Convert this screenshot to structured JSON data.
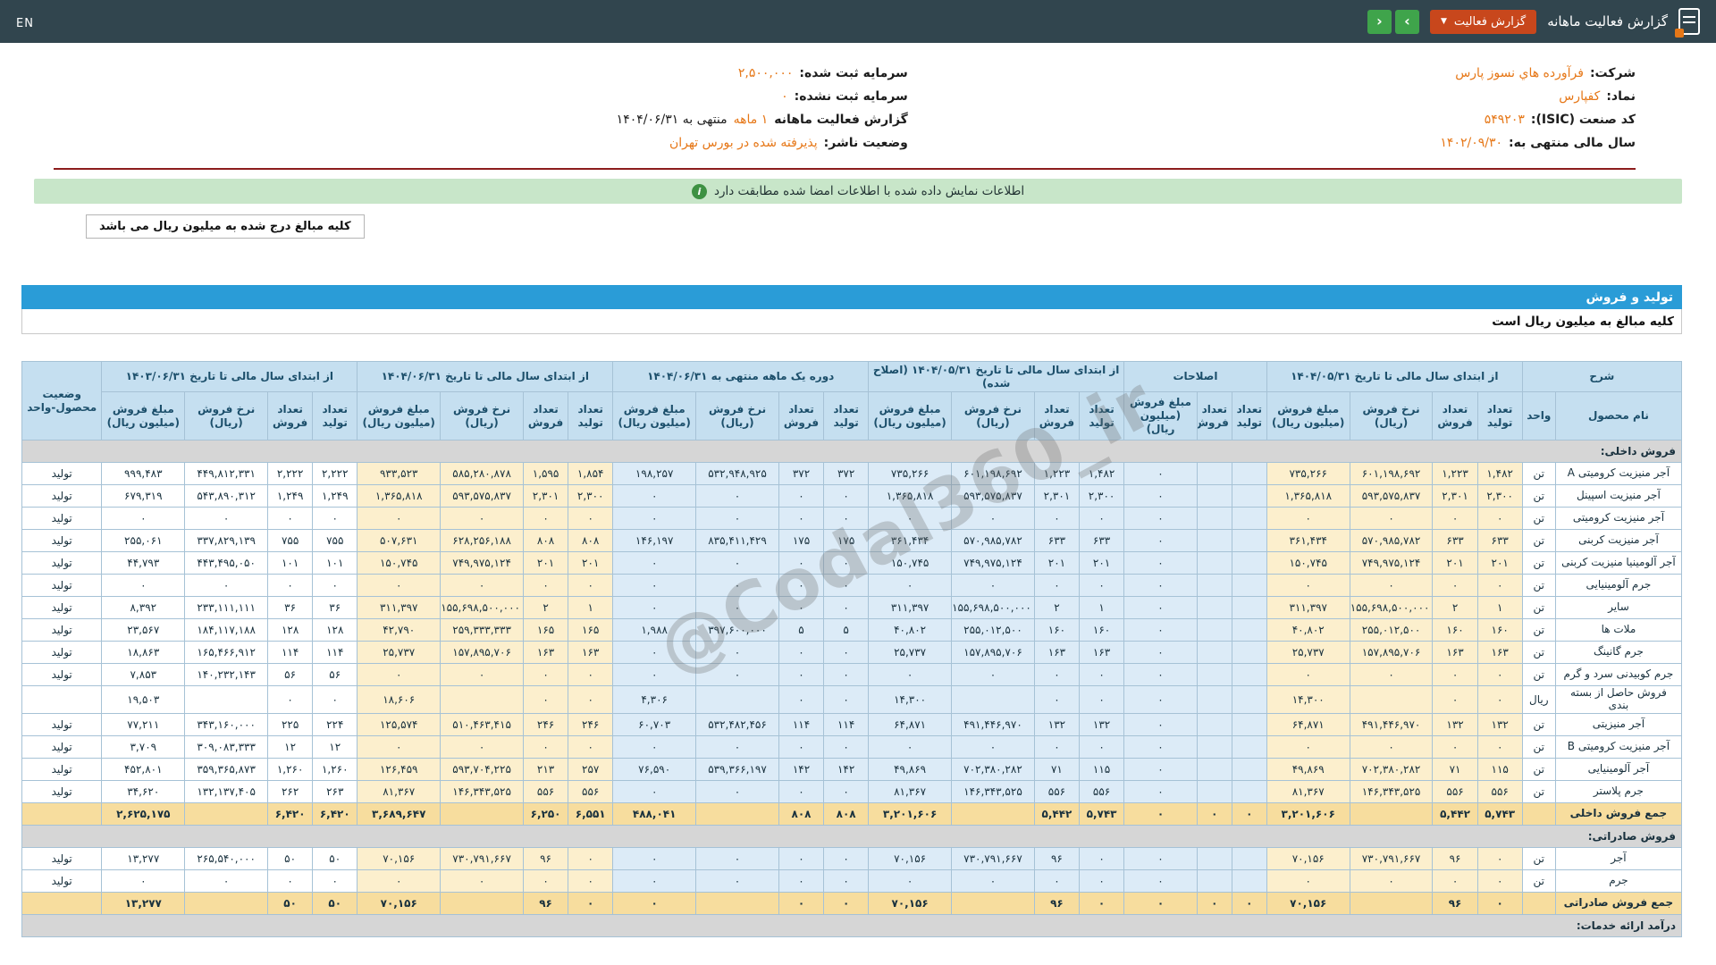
{
  "colors": {
    "topbar": "#31454e",
    "accent_orange": "#e67717",
    "button_red": "#c8471c",
    "button_green": "#3fa44b",
    "banner_green": "#c8e6c9",
    "bar_blue": "#2a9cd7",
    "header_blue": "#c5dff0",
    "header_text": "#1c4f6b",
    "cell_cream": "#fcefcd",
    "cell_blue": "#dcebf7",
    "total_yellow": "#f7dd9e",
    "section_gray": "#d6d6d6",
    "table_border": "#a6c2d6",
    "red_line": "#8c1d1d"
  },
  "topbar": {
    "title": "گزارش فعالیت ماهانه",
    "dropdown_label": "گزارش فعالیت",
    "dropdown_chevron": "▼",
    "nav_right": "›",
    "nav_left": "‹",
    "en_label": "EN"
  },
  "info": {
    "right": [
      {
        "label": "شرکت:",
        "value": "فرآورده هاي نسوز پارس",
        "suffix": ""
      },
      {
        "label": "نماد:",
        "value": "کفپارس",
        "suffix": ""
      },
      {
        "label": "کد صنعت (ISIC):",
        "value": "۵۴۹۲۰۳",
        "suffix": ""
      },
      {
        "label": "سال مالی منتهی به:",
        "value": "۱۴۰۲/۰۹/۳۰",
        "suffix": ""
      }
    ],
    "left": [
      {
        "label": "سرمایه ثبت شده:",
        "value": "۲,۵۰۰,۰۰۰",
        "suffix": ""
      },
      {
        "label": "سرمایه ثبت نشده:",
        "value": "۰",
        "suffix": ""
      },
      {
        "label": "گزارش فعالیت ماهانه",
        "value": "۱ ماهه",
        "suffix": "منتهی به ۱۴۰۴/۰۶/۳۱"
      },
      {
        "label": "وضعیت ناشر:",
        "value": "پذیرفته شده در بورس تهران",
        "suffix": ""
      }
    ]
  },
  "banner": {
    "text": "اطلاعات نمایش داده شده با اطلاعات امضا شده مطابقت دارد",
    "icon": "i"
  },
  "amounts_note": "کلیه مبالغ درج شده به میلیون ریال می باشد",
  "section_bar": "تولید و فروش",
  "table_note": "کلیه مبالغ به میلیون ریال است",
  "watermark": "@Codal360_ir",
  "table": {
    "desc_header": "شرح",
    "sub_name": "نام محصول",
    "sub_unit": "واحد",
    "status_header": "وضعیت محصول-واحد",
    "groups": [
      {
        "key": "ytd_0531",
        "shade": "s-cream",
        "label": "از ابتدای سال مالی تا تاریخ ۱۴۰۴/۰۵/۳۱",
        "cols": [
          "تعداد تولید",
          "تعداد فروش",
          "نرخ فروش (ریال)",
          "مبلغ فروش (میلیون ریال)"
        ]
      },
      {
        "key": "adjustments",
        "shade": "s-blue",
        "label": "اصلاحات",
        "cols": [
          "تعداد تولید",
          "تعداد فروش",
          "مبلغ فروش (میلیون ریال)"
        ]
      },
      {
        "key": "ytd_0531_adjusted",
        "shade": "s-blue",
        "label": "از ابتدای سال مالی تا تاریخ ۱۴۰۴/۰۵/۳۱ (اصلاح شده)",
        "cols": [
          "تعداد تولید",
          "تعداد فروش",
          "نرخ فروش (ریال)",
          "مبلغ فروش (میلیون ریال)"
        ]
      },
      {
        "key": "month_0631",
        "shade": "s-blue",
        "label": "دوره یک ماهه منتهی به ۱۴۰۴/۰۶/۳۱",
        "cols": [
          "تعداد تولید",
          "تعداد فروش",
          "نرخ فروش (ریال)",
          "مبلغ فروش (میلیون ریال)"
        ]
      },
      {
        "key": "ytd_0631",
        "shade": "s-cream",
        "label": "از ابتدای سال مالی تا تاریخ ۱۴۰۴/۰۶/۳۱",
        "cols": [
          "تعداد تولید",
          "تعداد فروش",
          "نرخ فروش (ریال)",
          "مبلغ فروش (میلیون ریال)"
        ]
      },
      {
        "key": "prev_1403",
        "shade": "s-plain",
        "label": "از ابتدای سال مالی تا تاریخ ۱۴۰۳/۰۶/۳۱",
        "cols": [
          "تعداد تولید",
          "تعداد فروش",
          "نرخ فروش (ریال)",
          "مبلغ فروش (میلیون ریال)"
        ]
      }
    ],
    "rows": [
      {
        "type": "section",
        "label": "فروش داخلی:"
      },
      {
        "type": "data",
        "name": "آجر منیزیت کرومیتی A",
        "unit": "تن",
        "status": "تولید",
        "values": {
          "ytd_0531": [
            "۱,۴۸۲",
            "۱,۲۲۳",
            "۶۰۱,۱۹۸,۶۹۲",
            "۷۳۵,۲۶۶"
          ],
          "adjustments": [
            "",
            "",
            "۰"
          ],
          "ytd_0531_adjusted": [
            "۱,۴۸۲",
            "۱,۲۲۳",
            "۶۰۱,۱۹۸,۶۹۲",
            "۷۳۵,۲۶۶"
          ],
          "month_0631": [
            "۳۷۲",
            "۳۷۲",
            "۵۳۲,۹۴۸,۹۲۵",
            "۱۹۸,۲۵۷"
          ],
          "ytd_0631": [
            "۱,۸۵۴",
            "۱,۵۹۵",
            "۵۸۵,۲۸۰,۸۷۸",
            "۹۳۳,۵۲۳"
          ],
          "prev_1403": [
            "۲,۲۲۲",
            "۲,۲۲۲",
            "۴۴۹,۸۱۲,۳۳۱",
            "۹۹۹,۴۸۳"
          ]
        }
      },
      {
        "type": "data",
        "name": "آجر منیزیت اسپینل",
        "unit": "تن",
        "status": "تولید",
        "values": {
          "ytd_0531": [
            "۲,۳۰۰",
            "۲,۳۰۱",
            "۵۹۳,۵۷۵,۸۳۷",
            "۱,۳۶۵,۸۱۸"
          ],
          "adjustments": [
            "",
            "",
            "۰"
          ],
          "ytd_0531_adjusted": [
            "۲,۳۰۰",
            "۲,۳۰۱",
            "۵۹۳,۵۷۵,۸۳۷",
            "۱,۳۶۵,۸۱۸"
          ],
          "month_0631": [
            "۰",
            "۰",
            "۰",
            "۰"
          ],
          "ytd_0631": [
            "۲,۳۰۰",
            "۲,۳۰۱",
            "۵۹۳,۵۷۵,۸۳۷",
            "۱,۳۶۵,۸۱۸"
          ],
          "prev_1403": [
            "۱,۲۴۹",
            "۱,۲۴۹",
            "۵۴۳,۸۹۰,۳۱۲",
            "۶۷۹,۳۱۹"
          ]
        }
      },
      {
        "type": "data",
        "name": "آجر منیزیت کرومیتی",
        "unit": "تن",
        "status": "تولید",
        "values": {
          "ytd_0531": [
            "۰",
            "۰",
            "۰",
            "۰"
          ],
          "adjustments": [
            "",
            "",
            "۰"
          ],
          "ytd_0531_adjusted": [
            "۰",
            "۰",
            "۰",
            "۰"
          ],
          "month_0631": [
            "۰",
            "۰",
            "۰",
            "۰"
          ],
          "ytd_0631": [
            "۰",
            "۰",
            "۰",
            "۰"
          ],
          "prev_1403": [
            "۰",
            "۰",
            "۰",
            "۰"
          ]
        }
      },
      {
        "type": "data",
        "name": "آجر منیزیت کربنی",
        "unit": "تن",
        "status": "تولید",
        "values": {
          "ytd_0531": [
            "۶۳۳",
            "۶۳۳",
            "۵۷۰,۹۸۵,۷۸۲",
            "۳۶۱,۴۳۴"
          ],
          "adjustments": [
            "",
            "",
            "۰"
          ],
          "ytd_0531_adjusted": [
            "۶۳۳",
            "۶۳۳",
            "۵۷۰,۹۸۵,۷۸۲",
            "۳۶۱,۴۳۴"
          ],
          "month_0631": [
            "۱۷۵",
            "۱۷۵",
            "۸۳۵,۴۱۱,۴۲۹",
            "۱۴۶,۱۹۷"
          ],
          "ytd_0631": [
            "۸۰۸",
            "۸۰۸",
            "۶۲۸,۲۵۶,۱۸۸",
            "۵۰۷,۶۳۱"
          ],
          "prev_1403": [
            "۷۵۵",
            "۷۵۵",
            "۳۳۷,۸۲۹,۱۳۹",
            "۲۵۵,۰۶۱"
          ]
        }
      },
      {
        "type": "data",
        "name": "آجر آلومینیا منیزیت کربنی",
        "unit": "تن",
        "status": "تولید",
        "values": {
          "ytd_0531": [
            "۲۰۱",
            "۲۰۱",
            "۷۴۹,۹۷۵,۱۲۴",
            "۱۵۰,۷۴۵"
          ],
          "adjustments": [
            "",
            "",
            "۰"
          ],
          "ytd_0531_adjusted": [
            "۲۰۱",
            "۲۰۱",
            "۷۴۹,۹۷۵,۱۲۴",
            "۱۵۰,۷۴۵"
          ],
          "month_0631": [
            "۰",
            "۰",
            "۰",
            "۰"
          ],
          "ytd_0631": [
            "۲۰۱",
            "۲۰۱",
            "۷۴۹,۹۷۵,۱۲۴",
            "۱۵۰,۷۴۵"
          ],
          "prev_1403": [
            "۱۰۱",
            "۱۰۱",
            "۴۴۳,۴۹۵,۰۵۰",
            "۴۴,۷۹۳"
          ]
        }
      },
      {
        "type": "data",
        "name": "جرم آلومینیایی",
        "unit": "تن",
        "status": "تولید",
        "values": {
          "ytd_0531": [
            "۰",
            "۰",
            "۰",
            "۰"
          ],
          "adjustments": [
            "",
            "",
            "۰"
          ],
          "ytd_0531_adjusted": [
            "۰",
            "۰",
            "۰",
            "۰"
          ],
          "month_0631": [
            "۰",
            "۰",
            "۰",
            "۰"
          ],
          "ytd_0631": [
            "۰",
            "۰",
            "۰",
            "۰"
          ],
          "prev_1403": [
            "۰",
            "۰",
            "۰",
            "۰"
          ]
        }
      },
      {
        "type": "data",
        "name": "سایر",
        "unit": "تن",
        "status": "تولید",
        "values": {
          "ytd_0531": [
            "۱",
            "۲",
            "۱۵۵,۶۹۸,۵۰۰,۰۰۰",
            "۳۱۱,۳۹۷"
          ],
          "adjustments": [
            "",
            "",
            "۰"
          ],
          "ytd_0531_adjusted": [
            "۱",
            "۲",
            "۱۵۵,۶۹۸,۵۰۰,۰۰۰",
            "۳۱۱,۳۹۷"
          ],
          "month_0631": [
            "۰",
            "۰",
            "۰",
            "۰"
          ],
          "ytd_0631": [
            "۱",
            "۲",
            "۱۵۵,۶۹۸,۵۰۰,۰۰۰",
            "۳۱۱,۳۹۷"
          ],
          "prev_1403": [
            "۳۶",
            "۳۶",
            "۲۳۳,۱۱۱,۱۱۱",
            "۸,۳۹۲"
          ]
        }
      },
      {
        "type": "data",
        "name": "ملات ها",
        "unit": "تن",
        "status": "تولید",
        "values": {
          "ytd_0531": [
            "۱۶۰",
            "۱۶۰",
            "۲۵۵,۰۱۲,۵۰۰",
            "۴۰,۸۰۲"
          ],
          "adjustments": [
            "",
            "",
            "۰"
          ],
          "ytd_0531_adjusted": [
            "۱۶۰",
            "۱۶۰",
            "۲۵۵,۰۱۲,۵۰۰",
            "۴۰,۸۰۲"
          ],
          "month_0631": [
            "۵",
            "۵",
            "۳۹۷,۶۰۰,۰۰۰",
            "۱,۹۸۸"
          ],
          "ytd_0631": [
            "۱۶۵",
            "۱۶۵",
            "۲۵۹,۳۳۳,۳۳۳",
            "۴۲,۷۹۰"
          ],
          "prev_1403": [
            "۱۲۸",
            "۱۲۸",
            "۱۸۴,۱۱۷,۱۸۸",
            "۲۳,۵۶۷"
          ]
        }
      },
      {
        "type": "data",
        "name": "جرم گانینگ",
        "unit": "تن",
        "status": "تولید",
        "values": {
          "ytd_0531": [
            "۱۶۳",
            "۱۶۳",
            "۱۵۷,۸۹۵,۷۰۶",
            "۲۵,۷۳۷"
          ],
          "adjustments": [
            "",
            "",
            "۰"
          ],
          "ytd_0531_adjusted": [
            "۱۶۳",
            "۱۶۳",
            "۱۵۷,۸۹۵,۷۰۶",
            "۲۵,۷۳۷"
          ],
          "month_0631": [
            "۰",
            "۰",
            "۰",
            "۰"
          ],
          "ytd_0631": [
            "۱۶۳",
            "۱۶۳",
            "۱۵۷,۸۹۵,۷۰۶",
            "۲۵,۷۳۷"
          ],
          "prev_1403": [
            "۱۱۴",
            "۱۱۴",
            "۱۶۵,۴۶۶,۹۱۲",
            "۱۸,۸۶۳"
          ]
        }
      },
      {
        "type": "data",
        "name": "جرم کوبیدنی سرد و گرم",
        "unit": "تن",
        "status": "تولید",
        "values": {
          "ytd_0531": [
            "۰",
            "۰",
            "۰",
            "۰"
          ],
          "adjustments": [
            "",
            "",
            "۰"
          ],
          "ytd_0531_adjusted": [
            "۰",
            "۰",
            "۰",
            "۰"
          ],
          "month_0631": [
            "۰",
            "۰",
            "۰",
            "۰"
          ],
          "ytd_0631": [
            "۰",
            "۰",
            "۰",
            "۰"
          ],
          "prev_1403": [
            "۵۶",
            "۵۶",
            "۱۴۰,۲۳۲,۱۴۳",
            "۷,۸۵۳"
          ]
        }
      },
      {
        "type": "data",
        "name": "فروش حاصل از بسته بندی",
        "unit": "ریال",
        "status": "",
        "values": {
          "ytd_0531": [
            "۰",
            "۰",
            "",
            "۱۴,۳۰۰"
          ],
          "adjustments": [
            "",
            "",
            "۰"
          ],
          "ytd_0531_adjusted": [
            "۰",
            "۰",
            "",
            "۱۴,۳۰۰"
          ],
          "month_0631": [
            "۰",
            "۰",
            "",
            "۴,۳۰۶"
          ],
          "ytd_0631": [
            "۰",
            "۰",
            "",
            "۱۸,۶۰۶"
          ],
          "prev_1403": [
            "۰",
            "۰",
            "",
            "۱۹,۵۰۳"
          ]
        }
      },
      {
        "type": "data",
        "name": "آجر منیزیتی",
        "unit": "تن",
        "status": "تولید",
        "values": {
          "ytd_0531": [
            "۱۳۲",
            "۱۳۲",
            "۴۹۱,۴۴۶,۹۷۰",
            "۶۴,۸۷۱"
          ],
          "adjustments": [
            "",
            "",
            "۰"
          ],
          "ytd_0531_adjusted": [
            "۱۳۲",
            "۱۳۲",
            "۴۹۱,۴۴۶,۹۷۰",
            "۶۴,۸۷۱"
          ],
          "month_0631": [
            "۱۱۴",
            "۱۱۴",
            "۵۳۲,۴۸۲,۴۵۶",
            "۶۰,۷۰۳"
          ],
          "ytd_0631": [
            "۲۴۶",
            "۲۴۶",
            "۵۱۰,۴۶۳,۴۱۵",
            "۱۲۵,۵۷۴"
          ],
          "prev_1403": [
            "۲۲۴",
            "۲۲۵",
            "۳۴۳,۱۶۰,۰۰۰",
            "۷۷,۲۱۱"
          ]
        }
      },
      {
        "type": "data",
        "name": "آجر منیزیت کرومیتی B",
        "unit": "تن",
        "status": "تولید",
        "values": {
          "ytd_0531": [
            "۰",
            "۰",
            "۰",
            "۰"
          ],
          "adjustments": [
            "",
            "",
            "۰"
          ],
          "ytd_0531_adjusted": [
            "۰",
            "۰",
            "۰",
            "۰"
          ],
          "month_0631": [
            "۰",
            "۰",
            "۰",
            "۰"
          ],
          "ytd_0631": [
            "۰",
            "۰",
            "۰",
            "۰"
          ],
          "prev_1403": [
            "۱۲",
            "۱۲",
            "۳۰۹,۰۸۳,۳۳۳",
            "۳,۷۰۹"
          ]
        }
      },
      {
        "type": "data",
        "name": "آجر آلومینیایی",
        "unit": "تن",
        "status": "تولید",
        "values": {
          "ytd_0531": [
            "۱۱۵",
            "۷۱",
            "۷۰۲,۳۸۰,۲۸۲",
            "۴۹,۸۶۹"
          ],
          "adjustments": [
            "",
            "",
            "۰"
          ],
          "ytd_0531_adjusted": [
            "۱۱۵",
            "۷۱",
            "۷۰۲,۳۸۰,۲۸۲",
            "۴۹,۸۶۹"
          ],
          "month_0631": [
            "۱۴۲",
            "۱۴۲",
            "۵۳۹,۳۶۶,۱۹۷",
            "۷۶,۵۹۰"
          ],
          "ytd_0631": [
            "۲۵۷",
            "۲۱۳",
            "۵۹۳,۷۰۴,۲۲۵",
            "۱۲۶,۴۵۹"
          ],
          "prev_1403": [
            "۱,۲۶۰",
            "۱,۲۶۰",
            "۳۵۹,۳۶۵,۸۷۳",
            "۴۵۲,۸۰۱"
          ]
        }
      },
      {
        "type": "data",
        "name": "جرم پلاستر",
        "unit": "تن",
        "status": "تولید",
        "values": {
          "ytd_0531": [
            "۵۵۶",
            "۵۵۶",
            "۱۴۶,۳۴۳,۵۲۵",
            "۸۱,۳۶۷"
          ],
          "adjustments": [
            "",
            "",
            "۰"
          ],
          "ytd_0531_adjusted": [
            "۵۵۶",
            "۵۵۶",
            "۱۴۶,۳۴۳,۵۲۵",
            "۸۱,۳۶۷"
          ],
          "month_0631": [
            "۰",
            "۰",
            "۰",
            "۰"
          ],
          "ytd_0631": [
            "۵۵۶",
            "۵۵۶",
            "۱۴۶,۳۴۳,۵۲۵",
            "۸۱,۳۶۷"
          ],
          "prev_1403": [
            "۲۶۳",
            "۲۶۲",
            "۱۳۲,۱۳۷,۴۰۵",
            "۳۴,۶۲۰"
          ]
        }
      },
      {
        "type": "total",
        "name": "جمع فروش داخلی",
        "unit": "",
        "status": "",
        "values": {
          "ytd_0531": [
            "۵,۷۴۳",
            "۵,۴۴۲",
            "",
            "۳,۲۰۱,۶۰۶"
          ],
          "adjustments": [
            "۰",
            "۰",
            "۰"
          ],
          "ytd_0531_adjusted": [
            "۵,۷۴۳",
            "۵,۴۴۲",
            "",
            "۳,۲۰۱,۶۰۶"
          ],
          "month_0631": [
            "۸۰۸",
            "۸۰۸",
            "",
            "۴۸۸,۰۴۱"
          ],
          "ytd_0631": [
            "۶,۵۵۱",
            "۶,۲۵۰",
            "",
            "۳,۶۸۹,۶۴۷"
          ],
          "prev_1403": [
            "۶,۴۲۰",
            "۶,۴۲۰",
            "",
            "۲,۶۲۵,۱۷۵"
          ]
        }
      },
      {
        "type": "section",
        "label": "فروش صادراتی:"
      },
      {
        "type": "data",
        "name": "آجر",
        "unit": "تن",
        "status": "تولید",
        "values": {
          "ytd_0531": [
            "۰",
            "۹۶",
            "۷۳۰,۷۹۱,۶۶۷",
            "۷۰,۱۵۶"
          ],
          "adjustments": [
            "",
            "",
            "۰"
          ],
          "ytd_0531_adjusted": [
            "۰",
            "۹۶",
            "۷۳۰,۷۹۱,۶۶۷",
            "۷۰,۱۵۶"
          ],
          "month_0631": [
            "۰",
            "۰",
            "۰",
            "۰"
          ],
          "ytd_0631": [
            "۰",
            "۹۶",
            "۷۳۰,۷۹۱,۶۶۷",
            "۷۰,۱۵۶"
          ],
          "prev_1403": [
            "۵۰",
            "۵۰",
            "۲۶۵,۵۴۰,۰۰۰",
            "۱۳,۲۷۷"
          ]
        }
      },
      {
        "type": "data",
        "name": "جرم",
        "unit": "تن",
        "status": "تولید",
        "values": {
          "ytd_0531": [
            "۰",
            "۰",
            "۰",
            "۰"
          ],
          "adjustments": [
            "",
            "",
            "۰"
          ],
          "ytd_0531_adjusted": [
            "۰",
            "۰",
            "۰",
            "۰"
          ],
          "month_0631": [
            "۰",
            "۰",
            "۰",
            "۰"
          ],
          "ytd_0631": [
            "۰",
            "۰",
            "۰",
            "۰"
          ],
          "prev_1403": [
            "۰",
            "۰",
            "۰",
            "۰"
          ]
        }
      },
      {
        "type": "total",
        "name": "جمع فروش صادراتی",
        "unit": "",
        "status": "",
        "values": {
          "ytd_0531": [
            "۰",
            "۹۶",
            "",
            "۷۰,۱۵۶"
          ],
          "adjustments": [
            "۰",
            "۰",
            "۰"
          ],
          "ytd_0531_adjusted": [
            "۰",
            "۹۶",
            "",
            "۷۰,۱۵۶"
          ],
          "month_0631": [
            "۰",
            "۰",
            "",
            "۰"
          ],
          "ytd_0631": [
            "۰",
            "۹۶",
            "",
            "۷۰,۱۵۶"
          ],
          "prev_1403": [
            "۵۰",
            "۵۰",
            "",
            "۱۳,۲۷۷"
          ]
        }
      },
      {
        "type": "section",
        "label": "درآمد ارائه خدمات:"
      }
    ]
  }
}
